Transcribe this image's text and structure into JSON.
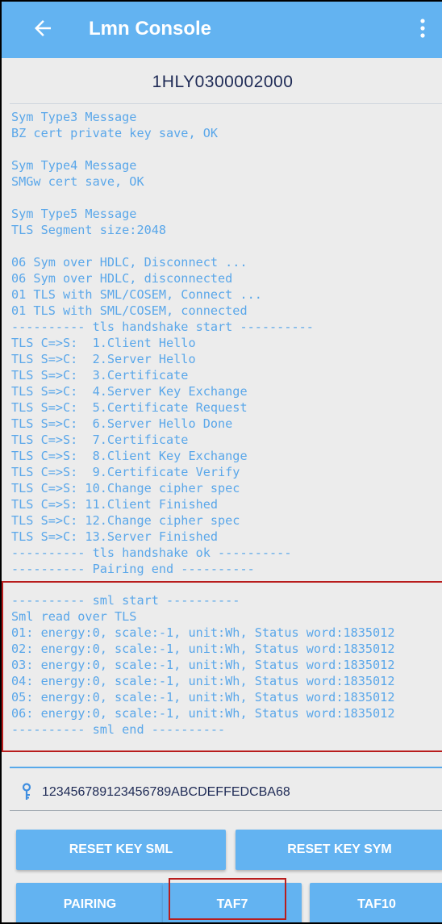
{
  "app_bar": {
    "title": "Lmn Console",
    "back_icon": "arrow-back-icon",
    "menu_icon": "more-vert-icon"
  },
  "device": {
    "id": "1HLY0300002000"
  },
  "log": {
    "lines": [
      "Sym Type3 Message",
      "BZ cert private key save, OK",
      "",
      "Sym Type4 Message",
      "SMGw cert save, OK",
      "",
      "Sym Type5 Message",
      "TLS Segment size:2048",
      "",
      "06 Sym over HDLC, Disconnect ...",
      "06 Sym over HDLC, disconnected",
      "01 TLS with SML/COSEM, Connect ...",
      "01 TLS with SML/COSEM, connected",
      "---------- tls handshake start ----------",
      "TLS C=>S:  1.Client Hello",
      "TLS S=>C:  2.Server Hello",
      "TLS S=>C:  3.Certificate",
      "TLS S=>C:  4.Server Key Exchange",
      "TLS S=>C:  5.Certificate Request",
      "TLS S=>C:  6.Server Hello Done",
      "TLS C=>S:  7.Certificate",
      "TLS C=>S:  8.Client Key Exchange",
      "TLS C=>S:  9.Certificate Verify",
      "TLS C=>S: 10.Change cipher spec",
      "TLS C=>S: 11.Client Finished",
      "TLS S=>C: 12.Change cipher spec",
      "TLS S=>C: 13.Server Finished",
      "---------- tls handshake ok ----------",
      "---------- Pairing end ----------",
      "",
      "---------- sml start ----------",
      "Sml read over TLS",
      "01: energy:0, scale:-1, unit:Wh, Status word:1835012",
      "02: energy:0, scale:-1, unit:Wh, Status word:1835012",
      "03: energy:0, scale:-1, unit:Wh, Status word:1835012",
      "04: energy:0, scale:-1, unit:Wh, Status word:1835012",
      "05: energy:0, scale:-1, unit:Wh, Status word:1835012",
      "06: energy:0, scale:-1, unit:Wh, Status word:1835012",
      "---------- sml end ----------"
    ]
  },
  "key_field": {
    "icon": "key-icon",
    "value": "123456789123456789ABCDEFFEDCBA68"
  },
  "buttons": {
    "reset_key_sml": "RESET KEY SML",
    "reset_key_sym": "RESET KEY SYM",
    "pairing": "PAIRING",
    "taf7": "TAF7",
    "taf10": "TAF10"
  },
  "colors": {
    "app_bar": "#63b3f1",
    "log_text": "#5aa7ea",
    "highlight": "#b81d1d",
    "background": "#ececec"
  }
}
